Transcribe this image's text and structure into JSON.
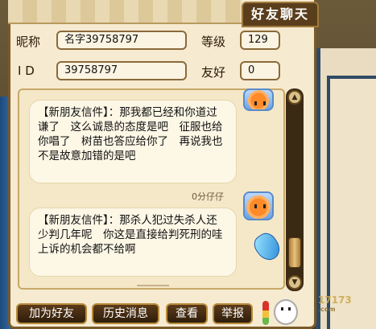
{
  "window": {
    "title": "好友聊天"
  },
  "profile": {
    "nickname_label": "昵称",
    "nickname_value": "名字39758797",
    "level_label": "等级",
    "level_value": "129",
    "id_label": "I D",
    "id_value": "39758797",
    "friendship_label": "友好",
    "friendship_value": "0"
  },
  "chat": {
    "messages": [
      {
        "text": "【新朋友信件】：那我都已经和你道过谦了　这么诚恳的态度是吧　征服也给你唱了　树苗也答应给你了　再说我也不是故意加错的是吧"
      },
      {
        "sender": "0分仔仔",
        "text": "【新朋友信件】：那杀人犯过失杀人还少判几年呢　你这是直接给判死刑的哇　上诉的机会都不给啊"
      }
    ]
  },
  "buttons": {
    "add_friend": "加为好友",
    "history": "历史消息",
    "view": "查看",
    "report": "举报"
  },
  "watermark": {
    "text": "17173",
    "sub": ".com"
  },
  "colors": {
    "panel_bg": "#f6ead0",
    "border": "#7a5a2a",
    "button_bg": "#2e1d0a"
  }
}
